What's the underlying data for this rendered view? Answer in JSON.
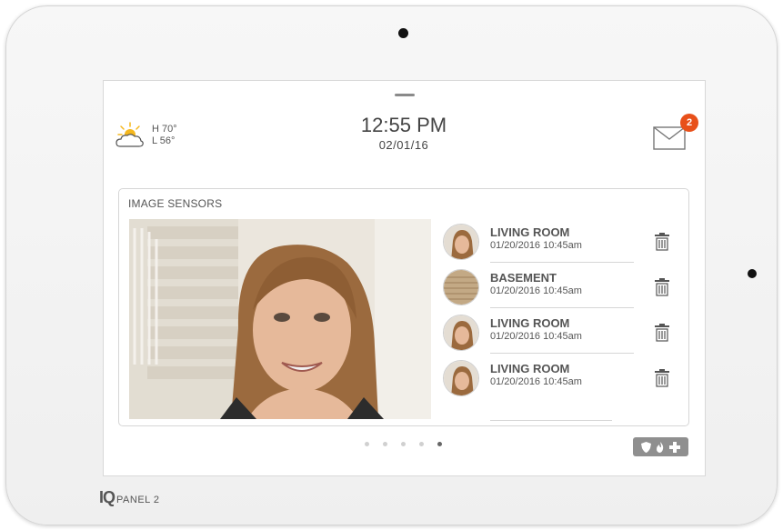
{
  "weather": {
    "icon": "partly-sunny-icon",
    "high": "H 70°",
    "low": "L 56°"
  },
  "clock": {
    "time": "12:55 PM",
    "date": "02/01/16"
  },
  "messages": {
    "icon": "envelope-icon",
    "unread_count": "2"
  },
  "image_sensors": {
    "title": "IMAGE SENSORS",
    "events": [
      {
        "name": "LIVING ROOM",
        "timestamp": "01/20/2016 10:45am",
        "thumb": "person"
      },
      {
        "name": "BASEMENT",
        "timestamp": "01/20/2016 10:45am",
        "thumb": "door"
      },
      {
        "name": "LIVING ROOM",
        "timestamp": "01/20/2016 10:45am",
        "thumb": "person"
      },
      {
        "name": "LIVING ROOM",
        "timestamp": "01/20/2016 10:45am",
        "thumb": "person"
      }
    ]
  },
  "pager": {
    "pages": 5,
    "active_index": 4
  },
  "panic_icons": [
    "shield-icon",
    "fire-icon",
    "medical-cross-icon"
  ],
  "brand": {
    "logo": "IQ",
    "model": "PANEL 2"
  },
  "colors": {
    "badge": "#e8501a",
    "text": "#555555",
    "sun": "#f5b81e"
  }
}
